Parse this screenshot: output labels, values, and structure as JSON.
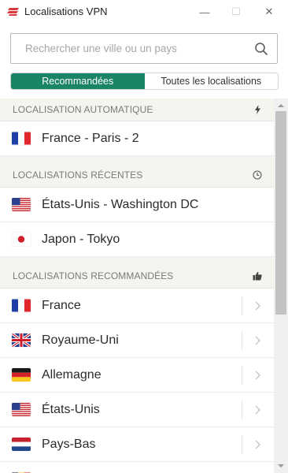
{
  "window": {
    "title": "Localisations VPN",
    "minimize_glyph": "—",
    "maximize_glyph": "☐",
    "close_glyph": "✕"
  },
  "search": {
    "placeholder": "Rechercher une ville ou un pays",
    "value": "",
    "icon": "search-icon"
  },
  "tabs": [
    {
      "label": "Recommandées",
      "active": true
    },
    {
      "label": "Toutes les localisations",
      "active": false
    }
  ],
  "sections": {
    "auto": {
      "header": "LOCALISATION AUTOMATIQUE",
      "icon": "lightning-icon",
      "items": [
        {
          "label": "France - Paris - 2",
          "flag": "fr"
        }
      ]
    },
    "recent": {
      "header": "LOCALISATIONS RÉCENTES",
      "icon": "clock-icon",
      "items": [
        {
          "label": "États-Unis - Washington DC",
          "flag": "us"
        },
        {
          "label": "Japon - Tokyo",
          "flag": "jp"
        }
      ]
    },
    "recommended": {
      "header": "LOCALISATIONS RECOMMANDÉES",
      "icon": "thumbs-up-icon",
      "items": [
        {
          "label": "France",
          "flag": "fr"
        },
        {
          "label": "Royaume-Uni",
          "flag": "uk"
        },
        {
          "label": "Allemagne",
          "flag": "de"
        },
        {
          "label": "États-Unis",
          "flag": "us"
        },
        {
          "label": "Pays-Bas",
          "flag": "nl"
        }
      ]
    }
  },
  "colors": {
    "accent": "#1a8467",
    "brand_red": "#da3940",
    "section_bg": "#f5f4ef"
  }
}
